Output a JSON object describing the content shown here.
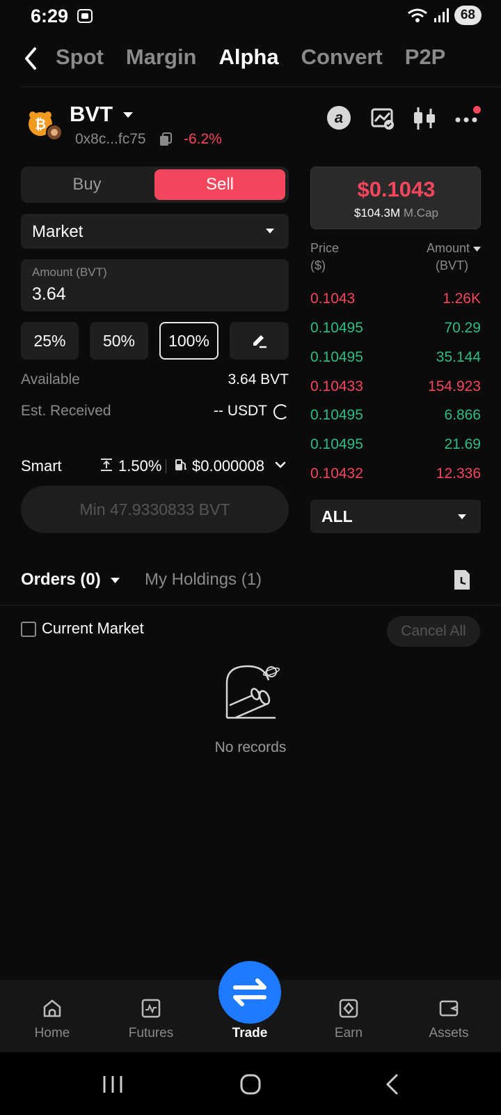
{
  "status": {
    "time": "6:29",
    "battery": "68"
  },
  "nav": {
    "tabs": [
      "Spot",
      "Margin",
      "Alpha",
      "Convert",
      "P2P"
    ],
    "active": "Alpha"
  },
  "token": {
    "symbol": "BVT",
    "address": "0x8c...fc75",
    "change": "-6.2%",
    "price": "$0.1043",
    "mcap_value": "$104.3M",
    "mcap_label": "M.Cap"
  },
  "trade": {
    "buy_label": "Buy",
    "sell_label": "Sell",
    "order_type": "Market",
    "amount_label": "Amount (BVT)",
    "amount_value": "3.64",
    "pct_buttons": [
      "25%",
      "50%",
      "100%"
    ],
    "available_label": "Available",
    "available_value": "3.64 BVT",
    "est_label": "Est. Received",
    "est_value": "-- USDT",
    "smart_label": "Smart",
    "slippage": "1.50%",
    "gas": "$0.000008",
    "min_button": "Min 47.9330833 BVT"
  },
  "orderbook": {
    "price_header_1": "Price",
    "price_header_2": "($)",
    "amount_header_1": "Amount",
    "amount_header_2": "(BVT)",
    "rows": [
      {
        "price": "0.1043",
        "amount": "1.26K",
        "side": "sell"
      },
      {
        "price": "0.10495",
        "amount": "70.29",
        "side": "buy"
      },
      {
        "price": "0.10495",
        "amount": "35.144",
        "side": "buy"
      },
      {
        "price": "0.10433",
        "amount": "154.923",
        "side": "sell"
      },
      {
        "price": "0.10495",
        "amount": "6.866",
        "side": "buy"
      },
      {
        "price": "0.10495",
        "amount": "21.69",
        "side": "buy"
      },
      {
        "price": "0.10432",
        "amount": "12.336",
        "side": "sell"
      }
    ],
    "filter": "ALL"
  },
  "orders": {
    "orders_tab": "Orders (0)",
    "holdings_tab": "My Holdings (1)",
    "current_market": "Current Market",
    "cancel_all": "Cancel All",
    "empty": "No records"
  },
  "bottom_nav": [
    {
      "label": "Home",
      "icon": "home-icon"
    },
    {
      "label": "Futures",
      "icon": "futures-icon"
    },
    {
      "label": "Trade",
      "icon": "swap-icon"
    },
    {
      "label": "Earn",
      "icon": "earn-icon"
    },
    {
      "label": "Assets",
      "icon": "wallet-icon"
    }
  ],
  "colors": {
    "sell": "#f6465d",
    "buy": "#2ebd85",
    "accent": "#1e7bff"
  }
}
